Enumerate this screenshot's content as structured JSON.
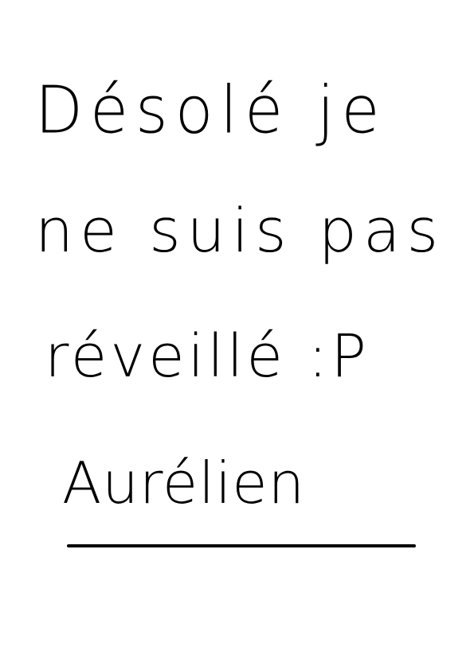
{
  "note": {
    "lines": [
      "Désolé je",
      "ne suis pas",
      "réveillé :P"
    ],
    "signature": "Aurélien"
  },
  "colors": {
    "ink": "#000000",
    "paper": "#ffffff"
  }
}
